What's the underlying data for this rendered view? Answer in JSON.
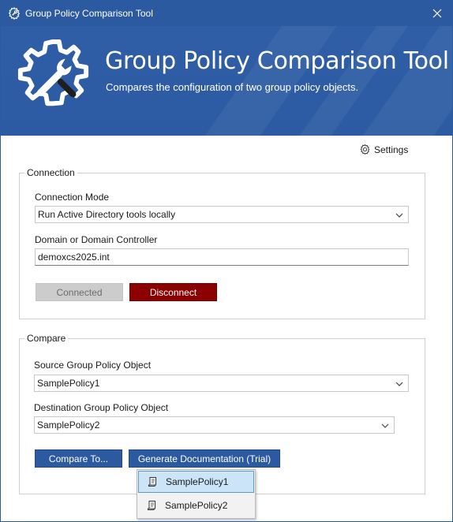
{
  "window": {
    "title": "Group Policy Comparison Tool",
    "close_glyph": "✕"
  },
  "banner": {
    "heading": "Group Policy Comparison Tool",
    "subtitle": "Compares the configuration of two group policy objects."
  },
  "settings": {
    "label": "Settings"
  },
  "connection": {
    "group_label": "Connection",
    "mode_label": "Connection Mode",
    "mode_value": "Run Active Directory tools locally",
    "domain_label": "Domain or Domain Controller",
    "domain_value": "demoxcs2025.int",
    "connected_button": "Connected",
    "disconnect_button": "Disconnect"
  },
  "compare": {
    "group_label": "Compare",
    "source_label": "Source Group Policy Object",
    "source_value": "SamplePolicy1",
    "dest_label": "Destination Group Policy Object",
    "dest_value": "SamplePolicy2",
    "compare_button": "Compare To...",
    "docs_button": "Generate Documentation (Trial)"
  },
  "dropdown": {
    "items": [
      {
        "label": "SamplePolicy1",
        "selected": true
      },
      {
        "label": "SamplePolicy2",
        "selected": false
      }
    ]
  },
  "colors": {
    "brand": "#2c5aa0",
    "danger": "#8b0000",
    "disabled": "#cccccc"
  },
  "icons": {
    "app": "gear-wrench-icon",
    "settings": "gear-icon",
    "combo": "chevron-down-icon",
    "policy": "scroll-icon"
  }
}
